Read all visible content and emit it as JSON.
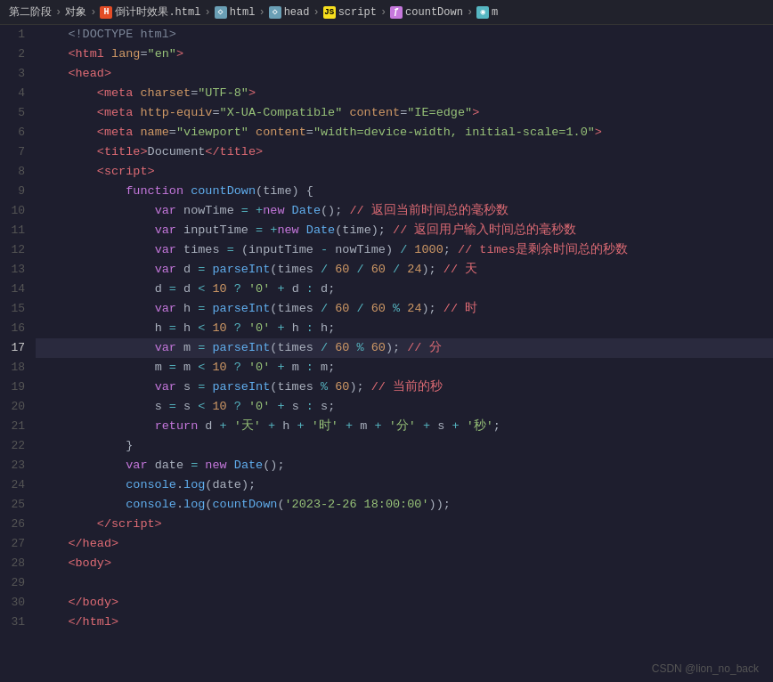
{
  "breadcrumb": {
    "items": [
      {
        "label": "第二阶段",
        "icon": null,
        "iconClass": null
      },
      {
        "label": "对象",
        "icon": null,
        "iconClass": null
      },
      {
        "label": "倒计时效果.html",
        "icon": "H",
        "iconClass": "bc-icon-html"
      },
      {
        "label": "html",
        "icon": "◇",
        "iconClass": "bc-icon-tag"
      },
      {
        "label": "head",
        "icon": "◇",
        "iconClass": "bc-icon-tag"
      },
      {
        "label": "script",
        "icon": "◇",
        "iconClass": "bc-icon-script"
      },
      {
        "label": "countDown",
        "icon": "ƒ",
        "iconClass": "bc-icon-func"
      },
      {
        "label": "m",
        "icon": "◎",
        "iconClass": "bc-icon-var"
      }
    ]
  },
  "watermark": "CSDN @lion_no_back"
}
